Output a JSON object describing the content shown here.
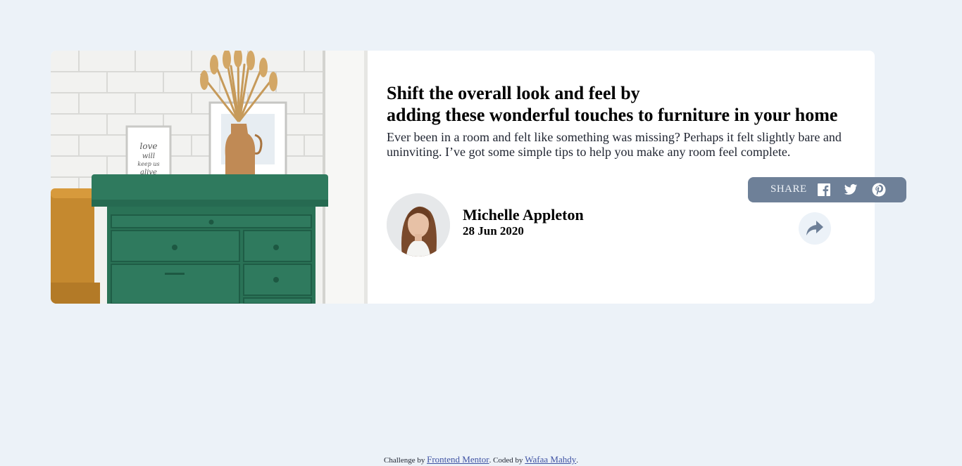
{
  "article": {
    "title_line1": "Shift the overall look and feel by",
    "title_line2": "adding these wonderful touches to furniture in your home",
    "description": "Ever been in a room and felt like something was missing? Perhaps it felt slightly bare and uninviting. I’ve got some simple tips to help you make any room feel complete.",
    "image_alt": "Green drawers with a vase and framed prints"
  },
  "author": {
    "name": "Michelle Appleton",
    "date": "28 Jun 2020"
  },
  "share": {
    "label": "SHARE",
    "icons": [
      "facebook-icon",
      "twitter-icon",
      "pinterest-icon"
    ],
    "button_icon": "share-arrow-icon"
  },
  "footer": {
    "challenge_prefix": "Challenge by",
    "challenge_link": "Frontend Mentor",
    "coded_prefix": ". Coded by",
    "coder_link": "Wafaa Mahdy",
    "suffix": "."
  },
  "colors": {
    "background": "#ecf2f8",
    "card": "#ffffff",
    "share_popup": "#6e8098",
    "link": "#3e52a3"
  }
}
